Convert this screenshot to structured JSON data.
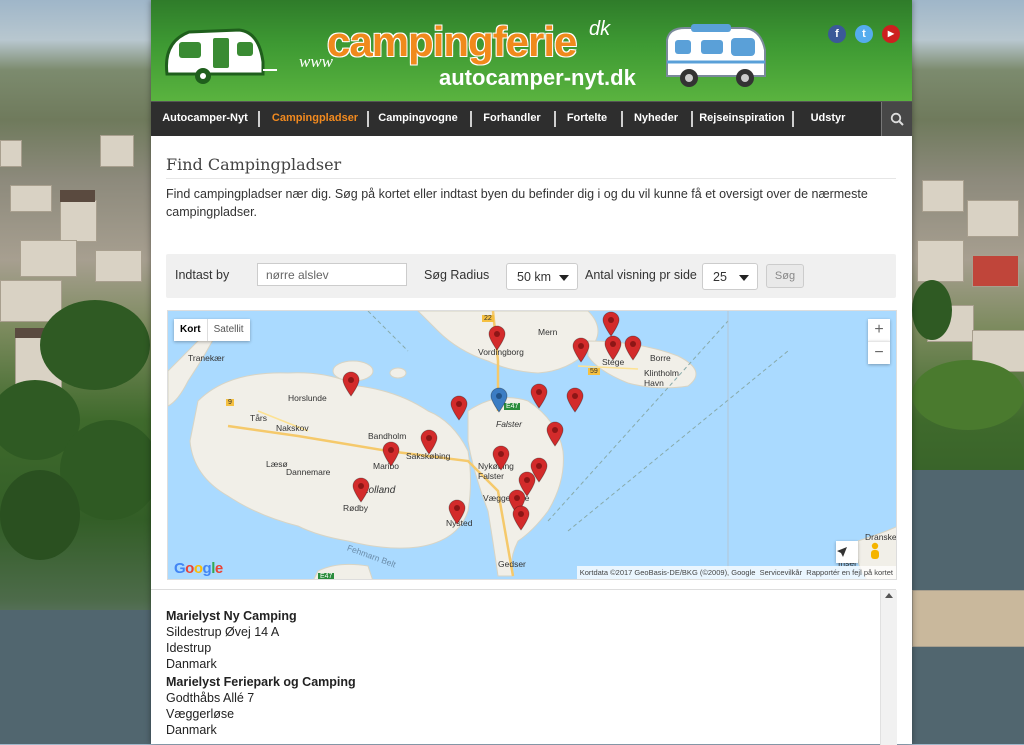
{
  "header": {
    "logo_www": "www",
    "logo_main": "campingferie",
    "logo_tld": "dk",
    "logo_sub": "autocamper-nyt.dk",
    "social": [
      {
        "icon": "facebook-icon",
        "glyph": "f",
        "color": "#3b5998"
      },
      {
        "icon": "twitter-icon",
        "glyph": "t",
        "color": "#55acee"
      },
      {
        "icon": "youtube-icon",
        "glyph": "▶",
        "color": "#cd201f"
      }
    ]
  },
  "nav": {
    "items": [
      {
        "label": "Autocamper-Nyt"
      },
      {
        "label": "Campingpladser",
        "active": true
      },
      {
        "label": "Campingvogne"
      },
      {
        "label": "Forhandler"
      },
      {
        "label": "Fortelte"
      },
      {
        "label": "Nyheder"
      },
      {
        "label": "Rejseinspiration"
      },
      {
        "label": "Udstyr"
      }
    ],
    "active_color": "#f28a1f"
  },
  "main": {
    "title": "Find Campingpladser",
    "intro": "Find campingpladser nær dig. Søg på kortet eller indtast byen du befinder dig i og du vil kunne få et oversigt over de nærmeste campingpladser."
  },
  "search": {
    "city_label": "Indtast by",
    "city_value": "nørre alslev",
    "radius_label": "Søg Radius",
    "radius_value": "50 km",
    "per_page_label": "Antal visning pr side",
    "per_page_value": "25",
    "submit_label": "Søg"
  },
  "map": {
    "type_map": "Kort",
    "type_satellite": "Satellit",
    "zoom_in": "+",
    "zoom_out": "−",
    "google": "Google",
    "attribution_data": "Kortdata ©2017 GeoBasis-DE/BKG (©2009), Google",
    "attribution_terms": "Servicevilkår",
    "attribution_report": "Rapportér en fejl på kortet",
    "labels": [
      {
        "text": "Tranekær"
      },
      {
        "text": "Horslunde"
      },
      {
        "text": "Tårs"
      },
      {
        "text": "Nakskov"
      },
      {
        "text": "Bandholm"
      },
      {
        "text": "Maribo"
      },
      {
        "text": "Sakskøbing"
      },
      {
        "text": "Læsø"
      },
      {
        "text": "Dannemare"
      },
      {
        "text": "Lolland"
      },
      {
        "text": "Rødby"
      },
      {
        "text": "Nysted"
      },
      {
        "text": "Vordingborg"
      },
      {
        "text": "Mern"
      },
      {
        "text": "Stege"
      },
      {
        "text": "Borre"
      },
      {
        "text": "Klintholm Havn"
      },
      {
        "text": "Falster"
      },
      {
        "text": "Nykøbing Falster"
      },
      {
        "text": "Væggerløse"
      },
      {
        "text": "Gedser"
      },
      {
        "text": "Fehmarn Belt"
      },
      {
        "text": "Dranske"
      },
      {
        "text": "Insel"
      },
      {
        "text": "E47"
      },
      {
        "text": "9"
      },
      {
        "text": "22"
      },
      {
        "text": "59"
      }
    ],
    "user_pin_color": "#3b7dc4",
    "pin_color": "#d32b2b"
  },
  "results": [
    {
      "name": "Marielyst Ny Camping",
      "street": "Sildestrup Øvej 14 A",
      "city": "Idestrup",
      "country": "Danmark"
    },
    {
      "name": "Marielyst Feriepark og Camping",
      "street": "Godthåbs Allé 7",
      "city": "Væggerløse",
      "country": "Danmark"
    }
  ]
}
